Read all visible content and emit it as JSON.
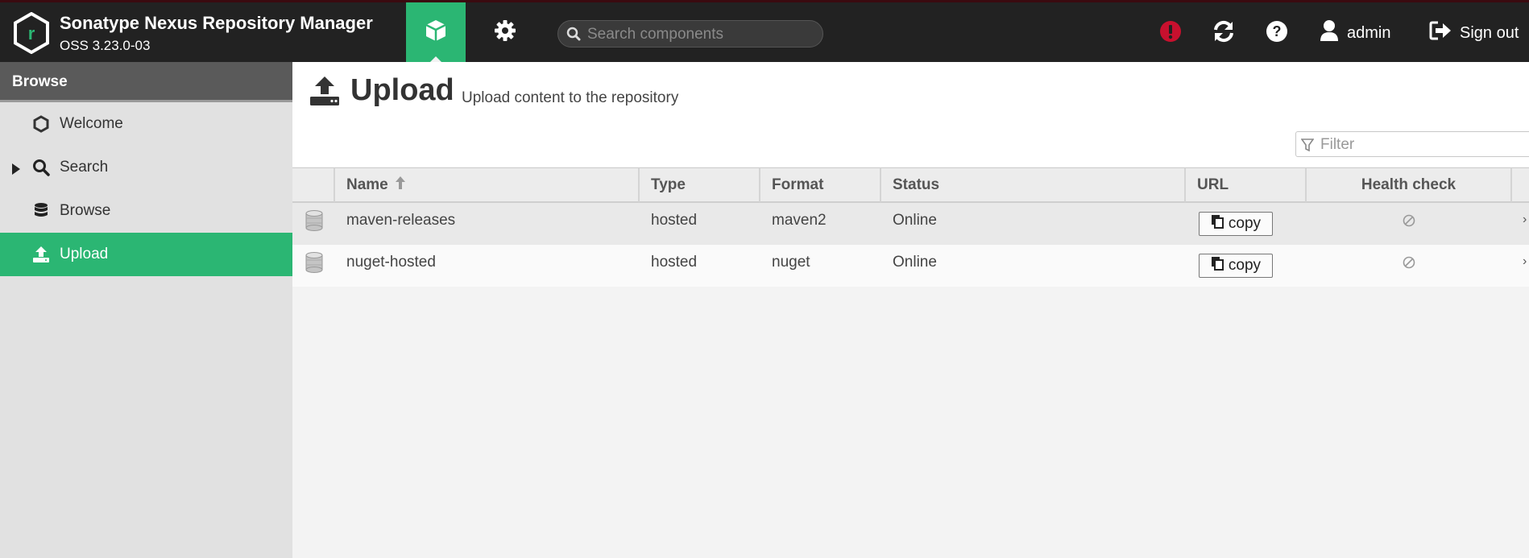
{
  "header": {
    "app_title": "Sonatype Nexus Repository Manager",
    "app_version": "OSS 3.23.0-03",
    "logo_letter": "r",
    "modes": [
      {
        "name": "browse",
        "icon": "cube-icon",
        "active": true
      },
      {
        "name": "administration",
        "icon": "gear-icon",
        "active": false
      }
    ],
    "search_placeholder": "Search components",
    "user_label": "admin",
    "signout_label": "Sign out",
    "colors": {
      "bar": "#222222",
      "accent": "#2bb673",
      "alert": "#c8102e"
    }
  },
  "sidebar": {
    "title": "Browse",
    "items": [
      {
        "label": "Welcome",
        "icon": "hexagon-icon",
        "expandable": false,
        "active": false
      },
      {
        "label": "Search",
        "icon": "search-icon",
        "expandable": true,
        "active": false
      },
      {
        "label": "Browse",
        "icon": "database-icon",
        "expandable": false,
        "active": false
      },
      {
        "label": "Upload",
        "icon": "upload-icon",
        "expandable": false,
        "active": true
      }
    ]
  },
  "page": {
    "title": "Upload",
    "subtitle": "Upload content to the repository",
    "filter_placeholder": "Filter"
  },
  "table": {
    "columns": [
      "Name",
      "Type",
      "Format",
      "Status",
      "URL",
      "Health check"
    ],
    "sort": {
      "column": "Name",
      "direction": "ascending"
    },
    "rows": [
      {
        "name": "maven-releases",
        "type": "hosted",
        "format": "maven2",
        "status": "Online",
        "url_button": "copy",
        "health_check": "disabled"
      },
      {
        "name": "nuget-hosted",
        "type": "hosted",
        "format": "nuget",
        "status": "Online",
        "url_button": "copy",
        "health_check": "disabled"
      }
    ]
  }
}
